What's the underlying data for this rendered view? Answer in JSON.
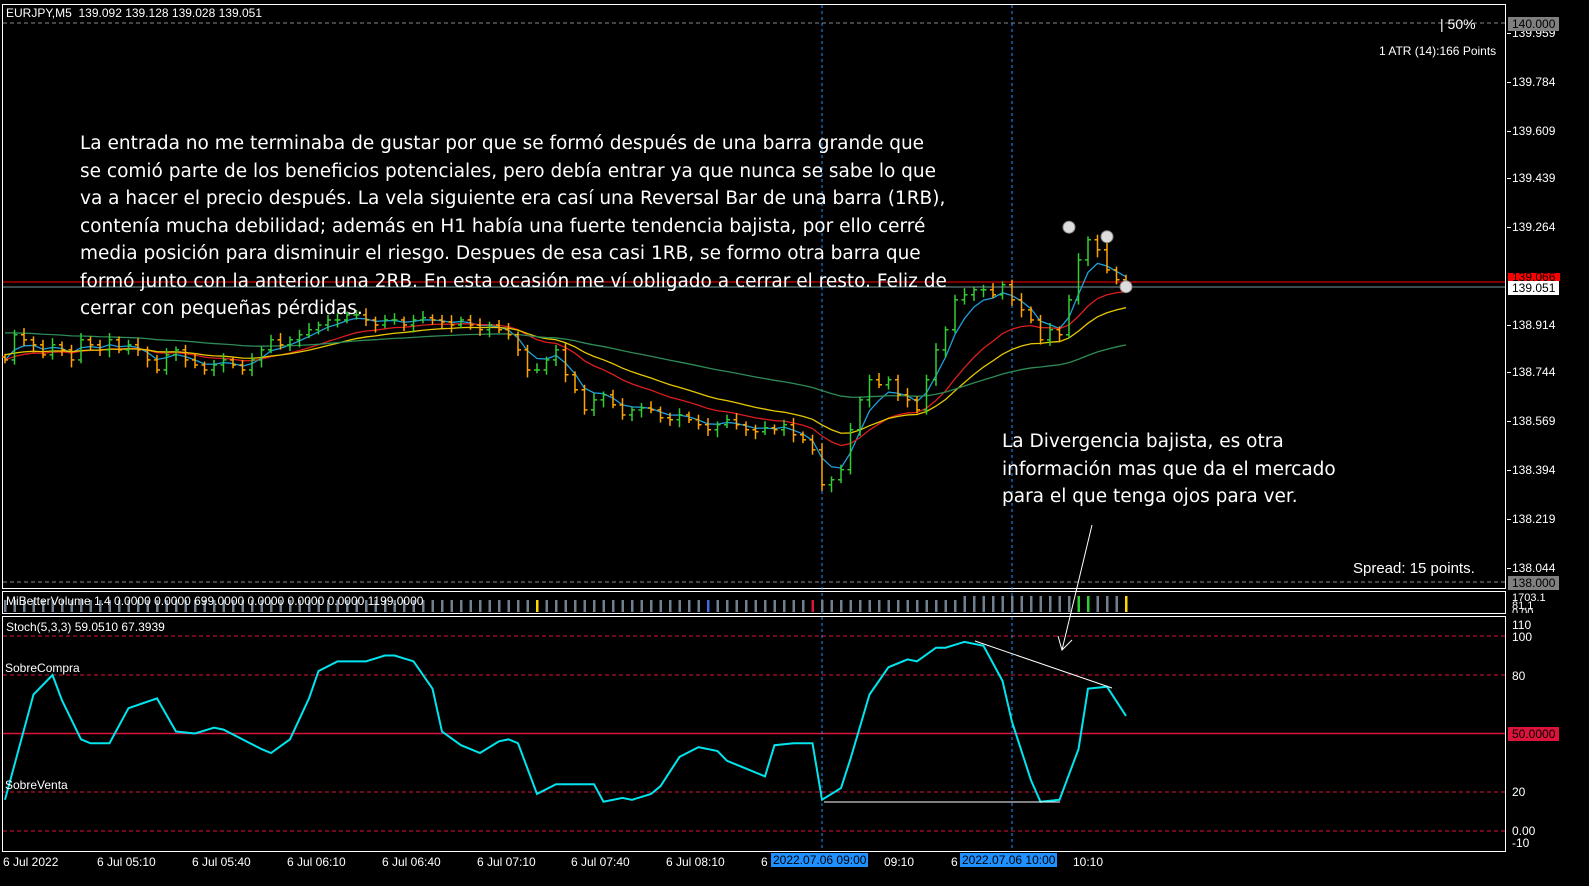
{
  "header": {
    "symbol": "EURJPY,M5",
    "ohlc": "139.092 139.128 139.028 139.051"
  },
  "overlay": {
    "percent": "50%",
    "atr": "1 ATR (14):166 Points",
    "spread": "Spread: 15 points."
  },
  "price_axis": {
    "labels": [
      "139.959",
      "139.784",
      "139.609",
      "139.439",
      "139.264",
      "138.914",
      "138.744",
      "138.569",
      "138.394",
      "138.219",
      "138.044"
    ],
    "top_marker": "140.000",
    "bottom_marker": "138.000",
    "current": "139.051",
    "red_marker": "139.066"
  },
  "volume": {
    "title": "MiBetterVolume 1.4 0.0000 0.0000 699.0000 0.0000 0.0000 0.0000 1199.0000",
    "axis": [
      "1703.1",
      "81.1",
      "0.00"
    ]
  },
  "stoch": {
    "title": "Stoch(5,3,3) 59.0510 67.3939",
    "overbought": "SobreCompra",
    "oversold": "SobreVenta",
    "axis": [
      "110",
      "100",
      "80",
      "20",
      "0.00",
      "-10"
    ],
    "level_marker": "50.0000"
  },
  "time_axis": {
    "labels": [
      "6 Jul 2022",
      "6 Jul 05:10",
      "6 Jul 05:40",
      "6 Jul 06:10",
      "6 Jul 06:40",
      "6 Jul 07:10",
      "6 Jul 07:40",
      "6 Jul 08:10",
      "6",
      "09:10",
      "6",
      "10:10"
    ],
    "highlight1": "2022.07.06 09:00",
    "highlight2": "2022.07.06 10:00"
  },
  "annotations": {
    "main": "La entrada no me terminaba de gustar por que se formó después de una barra grande que se comió parte de los beneficios potenciales, pero debía entrar ya que nunca se sabe lo que va a hacer el precio después. La vela siguiente era casí una Reversal Bar de una barra (1RB), contenía mucha debilidad; además en H1 había una fuerte tendencia bajista, por ello cerré media posición para disminuir el riesgo. Despues de esa casi 1RB, se formo otra barra que formó junto con la anterior una 2RB. En esta ocasión me ví obligado a cerrar el resto. Feliz de cerrar con pequeñas pérdidas.",
    "divergence": "La Divergencia bajista, es otra información mas que da el mercado para el que tenga ojos para ver."
  },
  "colors": {
    "bull": "#32cd32",
    "bear": "#ffa500",
    "ma_fast": "#1ea0dc",
    "ma_mid": "#dc1e1e",
    "ma_slow": "#e6c800",
    "ma_long": "#2e8b57",
    "stoch": "#00e5ee",
    "level": "#dc143c"
  },
  "chart_data": {
    "type": "ohlc",
    "symbol": "EURJPY",
    "timeframe": "M5",
    "ylim": [
      138.0,
      140.0
    ],
    "closes": [
      138.789,
      138.879,
      138.861,
      138.843,
      138.807,
      138.843,
      138.825,
      138.789,
      138.861,
      138.843,
      138.825,
      138.861,
      138.825,
      138.843,
      138.825,
      138.789,
      138.753,
      138.807,
      138.825,
      138.789,
      138.771,
      138.753,
      138.771,
      138.789,
      138.771,
      138.753,
      138.789,
      138.825,
      138.861,
      138.843,
      138.861,
      138.879,
      138.897,
      138.914,
      138.932,
      138.932,
      138.95,
      138.95,
      138.932,
      138.914,
      138.932,
      138.932,
      138.914,
      138.932,
      138.94,
      138.932,
      138.925,
      138.914,
      138.932,
      138.914,
      138.897,
      138.914,
      138.897,
      138.879,
      138.825,
      138.753,
      138.753,
      138.789,
      138.825,
      138.736,
      138.682,
      138.61,
      138.646,
      138.664,
      138.628,
      138.592,
      138.61,
      138.617,
      138.61,
      138.582,
      138.575,
      138.592,
      138.575,
      138.557,
      138.539,
      138.557,
      138.575,
      138.557,
      138.539,
      138.532,
      138.546,
      138.539,
      138.557,
      138.521,
      138.503,
      138.467,
      138.342,
      138.36,
      138.396,
      138.539,
      138.646,
      138.718,
      138.7,
      138.718,
      138.664,
      138.646,
      138.61,
      138.718,
      138.825,
      138.897,
      139.004,
      139.022,
      139.04,
      139.04,
      139.022,
      139.058,
      139.004,
      138.968,
      138.932,
      138.861,
      138.897,
      138.879,
      139.004,
      139.147,
      139.219,
      139.183,
      139.111,
      139.076,
      139.058
    ],
    "volume_colored": {
      "56": "#ffd700",
      "74": "#4169e1",
      "85": "#dc143c",
      "113": "#32cd32",
      "114": "#32cd32",
      "118": "#ffd700"
    },
    "stoch_points": [
      [
        0,
        16
      ],
      [
        3,
        70
      ],
      [
        5,
        80
      ],
      [
        6,
        67
      ],
      [
        8,
        47
      ],
      [
        9,
        45
      ],
      [
        11,
        45
      ],
      [
        13,
        63
      ],
      [
        16,
        68
      ],
      [
        18,
        51
      ],
      [
        20,
        50
      ],
      [
        22,
        53
      ],
      [
        23,
        52
      ],
      [
        25,
        47
      ],
      [
        27,
        42
      ],
      [
        28,
        40
      ],
      [
        30,
        47
      ],
      [
        32,
        68
      ],
      [
        33,
        82
      ],
      [
        35,
        87
      ],
      [
        38,
        87
      ],
      [
        40,
        90
      ],
      [
        41,
        90
      ],
      [
        43,
        87
      ],
      [
        45,
        73
      ],
      [
        46,
        51
      ],
      [
        48,
        44
      ],
      [
        50,
        40
      ],
      [
        52,
        46
      ],
      [
        53,
        47
      ],
      [
        54,
        45
      ],
      [
        56,
        19
      ],
      [
        58,
        24
      ],
      [
        61,
        24
      ],
      [
        62,
        24
      ],
      [
        63,
        15
      ],
      [
        65,
        17
      ],
      [
        66,
        16
      ],
      [
        68,
        19
      ],
      [
        69,
        23
      ],
      [
        71,
        38
      ],
      [
        73,
        43
      ],
      [
        75,
        41
      ],
      [
        76,
        36
      ],
      [
        78,
        32
      ],
      [
        80,
        28
      ],
      [
        81,
        44
      ],
      [
        83,
        45
      ],
      [
        85,
        45
      ],
      [
        86,
        16
      ],
      [
        88,
        22
      ],
      [
        89,
        37
      ],
      [
        91,
        70
      ],
      [
        93,
        84
      ],
      [
        95,
        88
      ],
      [
        96,
        87
      ],
      [
        98,
        94
      ],
      [
        99,
        94
      ],
      [
        101,
        97
      ],
      [
        103,
        95
      ],
      [
        105,
        77
      ],
      [
        106,
        56
      ],
      [
        108,
        26
      ],
      [
        109,
        15
      ],
      [
        111,
        16
      ],
      [
        113,
        42
      ],
      [
        114,
        73
      ],
      [
        116,
        74
      ],
      [
        118,
        59
      ]
    ],
    "stoch_levels": [
      100,
      80,
      50,
      20,
      0
    ],
    "event_bars": [
      86,
      106
    ]
  }
}
